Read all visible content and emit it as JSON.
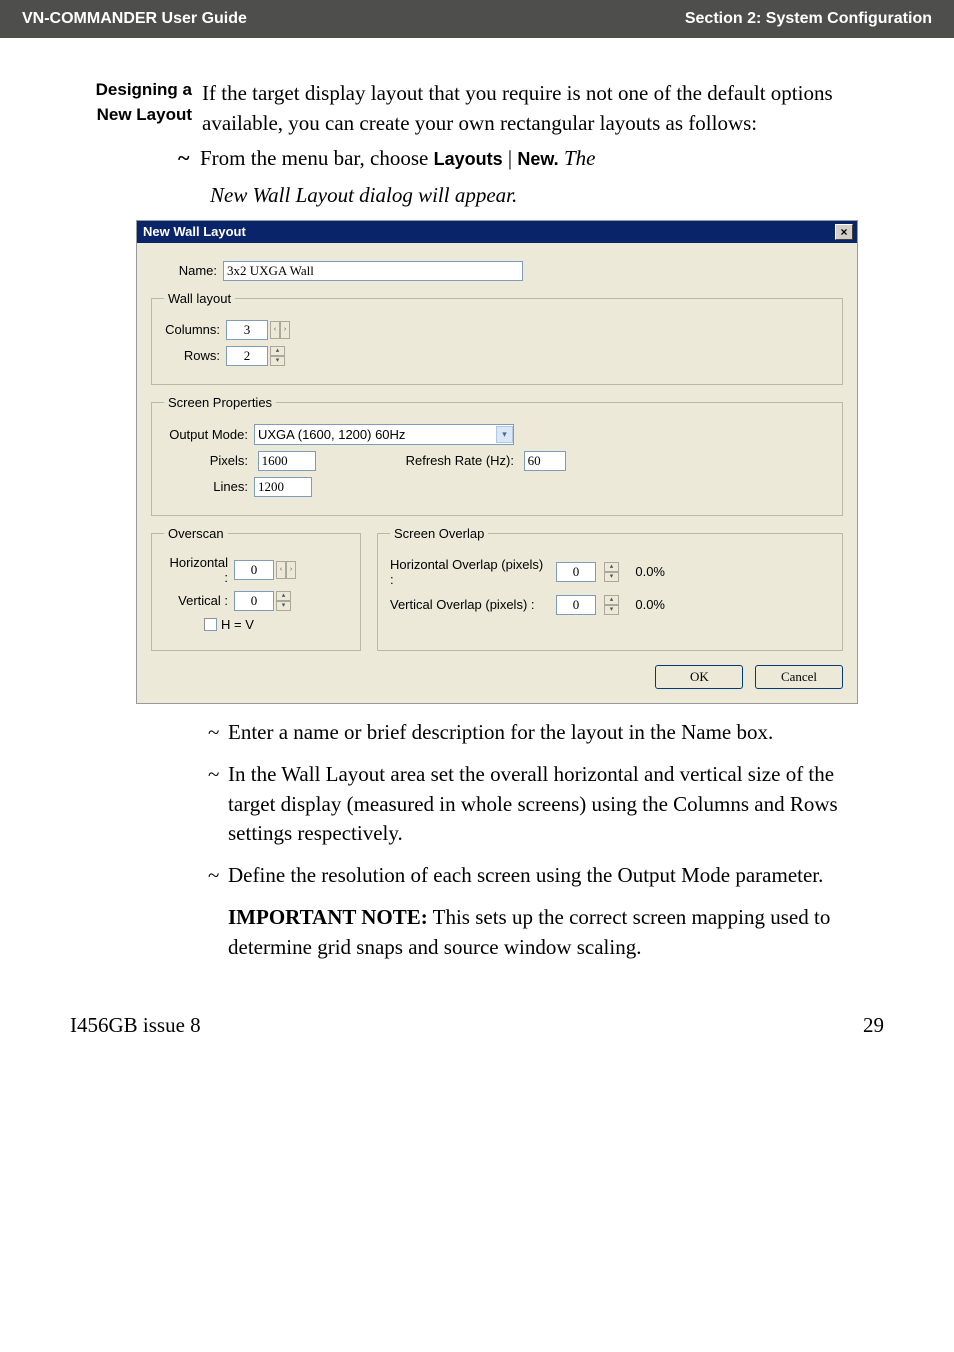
{
  "header": {
    "left": "VN-COMMANDER User Guide",
    "right": "Section 2: System Configuration"
  },
  "designing": {
    "side_label_line1": "Designing a",
    "side_label_line2": "New Layout",
    "para": "If the target display layout that you require is not one of the default options available, you can create your own rectangular layouts as follows:"
  },
  "step1": {
    "prefix": "From the menu bar, choose ",
    "menu1": "Layouts",
    "sep": " | ",
    "menu2": "New.",
    "suffix_italic": " The"
  },
  "caption": "New Wall Layout dialog will appear.",
  "dialog": {
    "title": "New Wall Layout",
    "name_label": "Name:",
    "name_value": "3x2 UXGA Wall",
    "wall_layout_legend": "Wall layout",
    "columns_label": "Columns:",
    "columns_value": "3",
    "rows_label": "Rows:",
    "rows_value": "2",
    "screen_props_legend": "Screen Properties",
    "output_mode_label": "Output Mode:",
    "output_mode_value": "UXGA (1600, 1200) 60Hz",
    "pixels_label": "Pixels:",
    "pixels_value": "1600",
    "lines_label": "Lines:",
    "lines_value": "1200",
    "refresh_label": "Refresh Rate (Hz):",
    "refresh_value": "60",
    "overscan_legend": "Overscan",
    "overscan_h_label": "Horizontal :",
    "overscan_h_value": "0",
    "overscan_v_label": "Vertical :",
    "overscan_v_value": "0",
    "hv_label": "H = V",
    "overlap_legend": "Screen Overlap",
    "overlap_h_label": "Horizontal Overlap (pixels) :",
    "overlap_h_value": "0",
    "overlap_h_pct": "0.0%",
    "overlap_v_label": "Vertical Overlap (pixels) :",
    "overlap_v_value": "0",
    "overlap_v_pct": "0.0%",
    "ok": "OK",
    "cancel": "Cancel"
  },
  "bullets": {
    "b1": "Enter a name or brief description for the layout in the Name box.",
    "b2": "In the Wall Layout area set the overall horizontal and vertical size of the target display (measured in whole screens) using the Columns and Rows settings respectively.",
    "b3": "Define the resolution of each screen using the Output Mode parameter."
  },
  "note": {
    "lead": "IMPORTANT NOTE:",
    "body": " This sets up the correct screen mapping used to determine grid snaps and source window scaling."
  },
  "footer": {
    "left": "I456GB issue 8",
    "right": "29"
  }
}
